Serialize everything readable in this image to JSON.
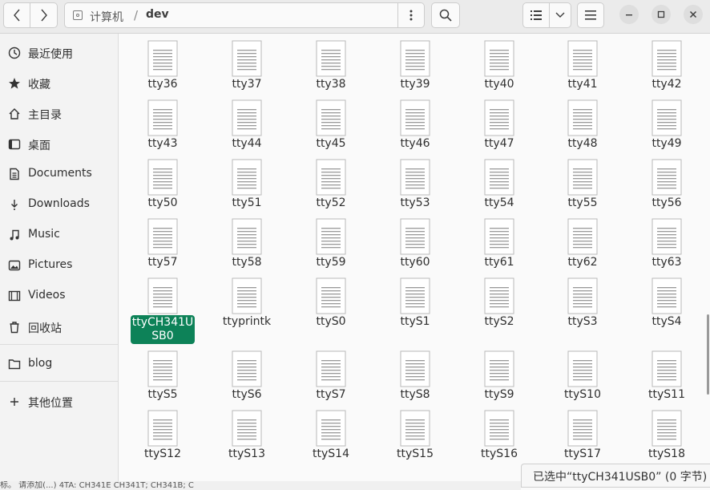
{
  "header": {
    "breadcrumb_root": "计算机",
    "breadcrumb_sep": "/",
    "breadcrumb_current": "dev"
  },
  "sidebar": {
    "items": [
      {
        "label": "最近使用",
        "icon": "clock-icon"
      },
      {
        "label": "收藏",
        "icon": "star-icon"
      },
      {
        "label": "主目录",
        "icon": "home-icon"
      },
      {
        "label": "桌面",
        "icon": "desktop-icon"
      },
      {
        "label": "Documents",
        "icon": "document-icon"
      },
      {
        "label": "Downloads",
        "icon": "download-icon"
      },
      {
        "label": "Music",
        "icon": "music-icon"
      },
      {
        "label": "Pictures",
        "icon": "picture-icon"
      },
      {
        "label": "Videos",
        "icon": "video-icon"
      },
      {
        "label": "回收站",
        "icon": "trash-icon"
      },
      {
        "label": "blog",
        "icon": "folder-icon"
      },
      {
        "label": "其他位置",
        "icon": "plus-icon"
      }
    ]
  },
  "files": {
    "rows": [
      [
        "tty36",
        "tty37",
        "tty38",
        "tty39",
        "tty40",
        "tty41",
        "tty42"
      ],
      [
        "tty43",
        "tty44",
        "tty45",
        "tty46",
        "tty47",
        "tty48",
        "tty49"
      ],
      [
        "tty50",
        "tty51",
        "tty52",
        "tty53",
        "tty54",
        "tty55",
        "tty56"
      ],
      [
        "tty57",
        "tty58",
        "tty59",
        "tty60",
        "tty61",
        "tty62",
        "tty63"
      ],
      [
        "ttyCH341USB0",
        "ttyprintk",
        "ttyS0",
        "ttyS1",
        "ttyS2",
        "ttyS3",
        "ttyS4"
      ],
      [
        "ttyS5",
        "ttyS6",
        "ttyS7",
        "ttyS8",
        "ttyS9",
        "ttyS10",
        "ttyS11"
      ],
      [
        "ttyS12",
        "ttyS13",
        "ttyS14",
        "ttyS15",
        "ttyS16",
        "ttyS17",
        "ttyS18"
      ]
    ],
    "selected": "ttyCH341USB0"
  },
  "status": {
    "text": "已选中“ttyCH341USB0” (0 字节)"
  },
  "background_window": {
    "text": "标。 请添加(...)          4TA: CH341E CH341T; CH341B; C"
  },
  "colors": {
    "selection": "#0d8258",
    "header_bg": "#ebebeb",
    "sidebar_bg": "#f3f3f3"
  }
}
